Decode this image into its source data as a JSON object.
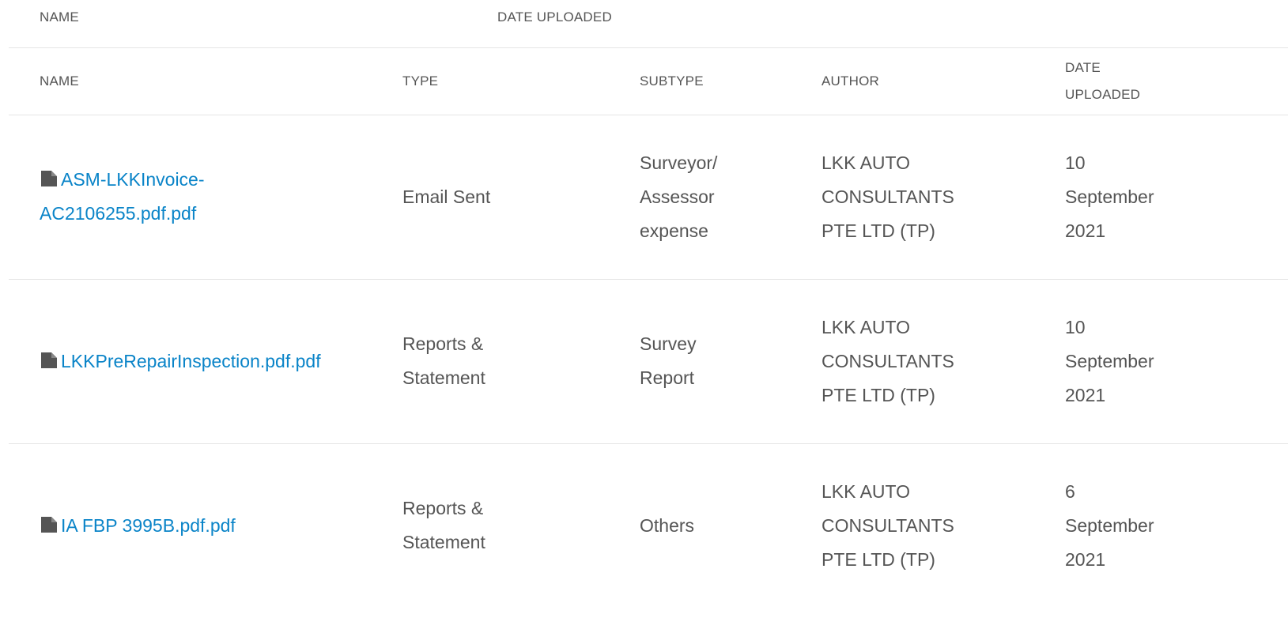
{
  "top_header": {
    "name_label": "NAME",
    "date_label": "DATE UPLOADED"
  },
  "table": {
    "headers": {
      "name": "NAME",
      "type": "TYPE",
      "subtype": "SUBTYPE",
      "author": "AUTHOR",
      "date": "DATE UPLOADED"
    },
    "rows": [
      {
        "name": "ASM-LKKInvoice-AC2106255.pdf.pdf",
        "type": "Email Sent",
        "subtype": "Surveyor/ Assessor expense",
        "author": "LKK AUTO CONSULTANTS PTE LTD (TP)",
        "date": "10 September 2021"
      },
      {
        "name": "LKKPreRepairInspection.pdf.pdf",
        "type": "Reports & Statement",
        "subtype": "Survey Report",
        "author": "LKK AUTO CONSULTANTS PTE LTD (TP)",
        "date": "10 September 2021"
      },
      {
        "name": "IA FBP 3995B.pdf.pdf",
        "type": "Reports & Statement",
        "subtype": "Others",
        "author": "LKK AUTO CONSULTANTS PTE LTD (TP)",
        "date": "6 September 2021"
      }
    ]
  },
  "colors": {
    "link": "#0a84c8",
    "text": "#555555",
    "icon": "#555555",
    "divider": "#e5e5e5"
  },
  "icons": {
    "file": "file-icon"
  }
}
